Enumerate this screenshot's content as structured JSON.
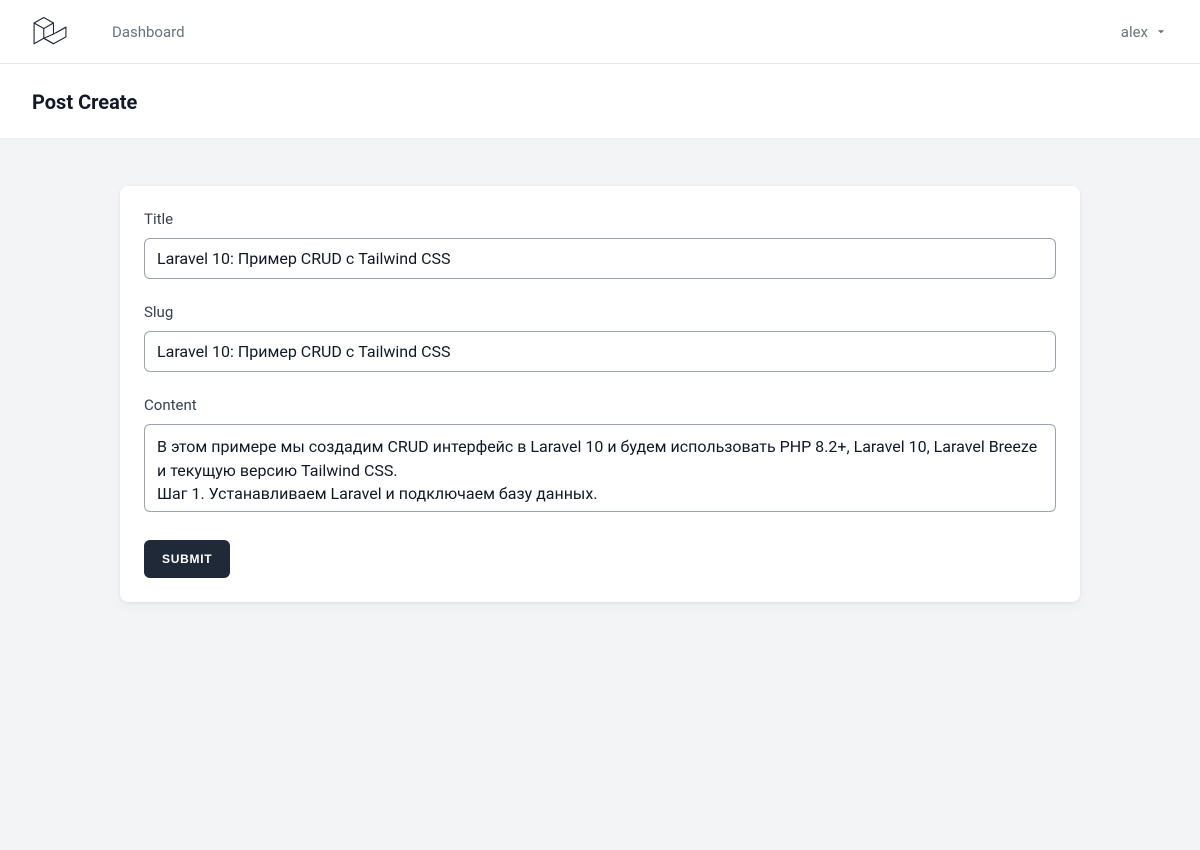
{
  "nav": {
    "dashboard_label": "Dashboard",
    "user_name": "alex"
  },
  "page": {
    "title": "Post Create"
  },
  "form": {
    "title_label": "Title",
    "title_value": "Laravel 10: Пример CRUD с Tailwind CSS",
    "slug_label": "Slug",
    "slug_value": "Laravel 10: Пример CRUD с Tailwind CSS",
    "content_label": "Content",
    "content_value": "В этом примере мы создадим CRUD интерфейс в Laravel 10 и будем использовать PHP 8.2+, Laravel 10, Laravel Breeze и текущую версию Tailwind CSS.\nШаг 1. Устанавливаем Laravel и подключаем базу данных.",
    "submit_label": "Submit"
  }
}
